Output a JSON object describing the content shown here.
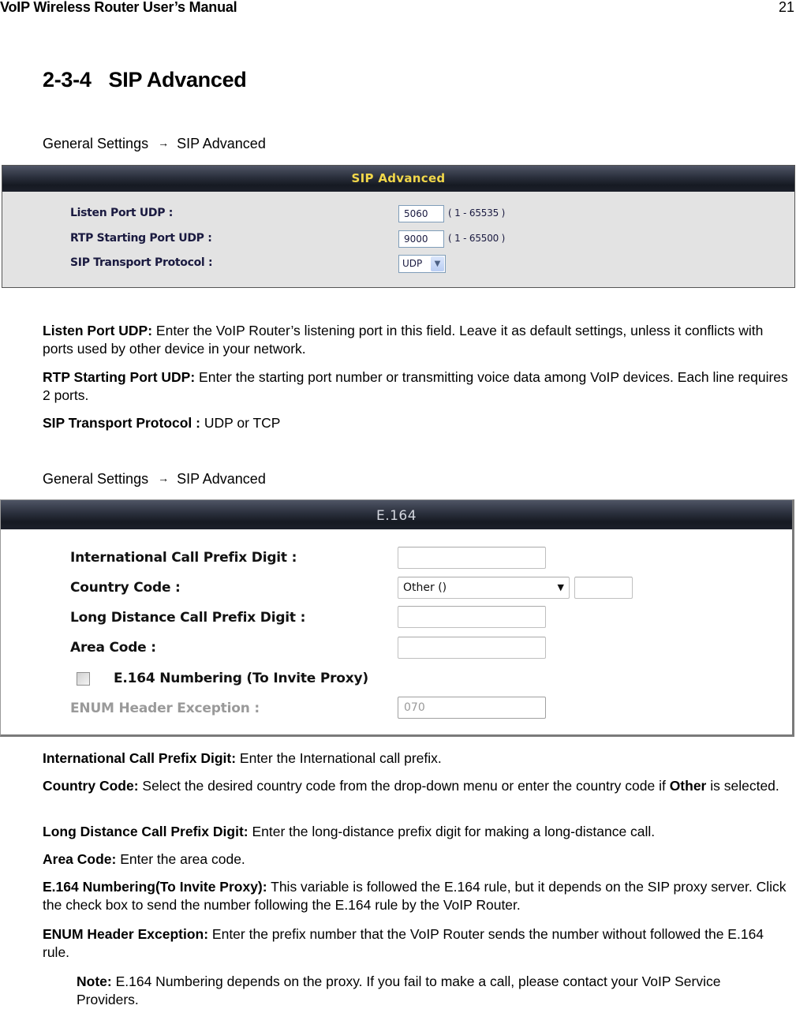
{
  "running_header": {
    "title": "VoIP Wireless Router User’s Manual",
    "page_number": "21"
  },
  "section": {
    "number": "2-3-4",
    "title": "SIP Advanced"
  },
  "breadcrumbs": [
    {
      "parent": "General Settings",
      "arrow": "→",
      "current": "SIP Advanced"
    },
    {
      "parent": "General Settings",
      "arrow": "→",
      "current": "SIP Advanced"
    }
  ],
  "sip_panel": {
    "title": "SIP Advanced",
    "colors": {
      "title": "#f2d84a",
      "background": "#e3e3e3",
      "header_dark": "#161a22"
    },
    "fields": [
      {
        "label": "Listen Port UDP :",
        "value": "5060",
        "range": "( 1 - 65535 )"
      },
      {
        "label": "RTP Starting Port UDP :",
        "value": "9000",
        "range": "( 1 - 65500 )"
      },
      {
        "label": "SIP Transport Protocol :",
        "selected": "UDP",
        "icon": "chevron-down-icon"
      }
    ]
  },
  "e164_panel": {
    "title": "E.164",
    "colors": {
      "title": "#d4d7df",
      "background": "#ffffff",
      "disabled_text": "#9a9a9a"
    },
    "fields": [
      {
        "label": "International Call Prefix Digit :",
        "value": ""
      },
      {
        "label": "Country Code :",
        "selected": "Other ()",
        "extra_value": ""
      },
      {
        "label": "Long Distance Call Prefix Digit :",
        "value": ""
      },
      {
        "label": "Area Code :",
        "value": ""
      },
      {
        "label": "E.164 Numbering (To Invite Proxy)",
        "checked": false
      },
      {
        "label": "ENUM Header Exception :",
        "value": "070",
        "disabled": true
      }
    ]
  },
  "descriptions_sip": [
    {
      "term": "Listen Port UDP:",
      "text": " Enter the VoIP Router’s listening port in this field. Leave it as default settings, unless it conflicts with ports used by other device in your network."
    },
    {
      "term": "RTP Starting Port UDP:",
      "text": " Enter the starting port number or transmitting voice data among VoIP devices. Each line requires 2 ports."
    },
    {
      "term": "SIP Transport Protocol :",
      "text": " UDP or TCP"
    }
  ],
  "descriptions_e164": [
    {
      "term": "International Call Prefix Digit:",
      "text": " Enter the International call prefix."
    },
    {
      "term": "Country Code:",
      "text": " Select the desired country code from the drop-down menu or enter the country code if ",
      "term2": "Other",
      "text2": " is selected."
    },
    {
      "term": "Long Distance Call Prefix Digit:",
      "text": " Enter the long-distance prefix digit for making a long-distance call."
    },
    {
      "term": "Area Code:",
      "text": " Enter the area code."
    },
    {
      "term": "E.164 Numbering(To Invite Proxy):",
      "text": " This variable is followed the E.164 rule, but it depends on the SIP proxy server. Click the check box to send the number following the E.164 rule by the VoIP Router."
    },
    {
      "term": "ENUM Header Exception:",
      "text": " Enter the prefix number that the VoIP Router sends the number without followed the E.164 rule."
    }
  ],
  "note": {
    "term": "Note:",
    "text": " E.164 Numbering depends on the proxy. If you fail to make a call, please contact your VoIP Service Providers."
  }
}
